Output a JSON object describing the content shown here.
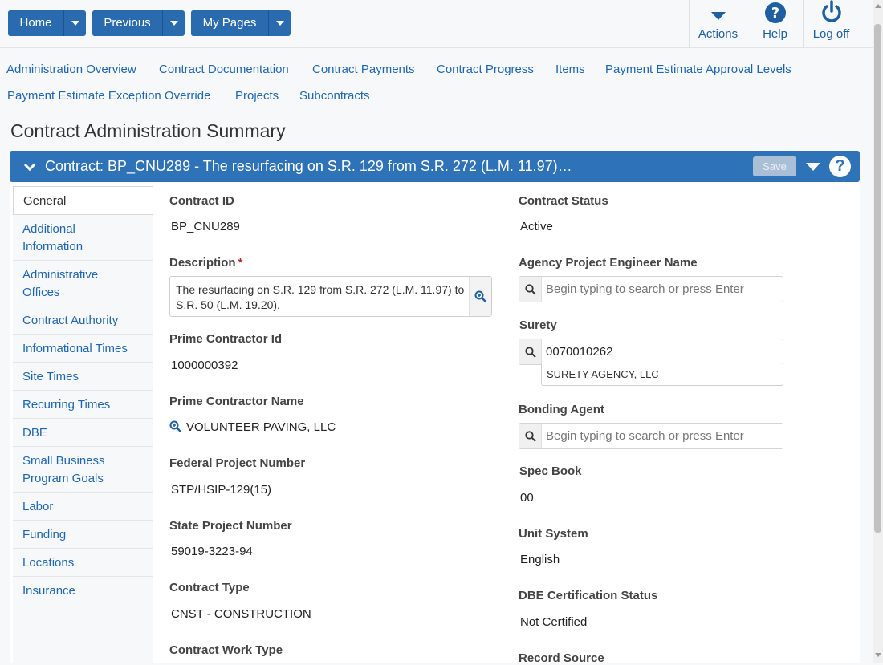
{
  "colors": {
    "brand_blue": "#2e72b8",
    "link_blue": "#1f66b0",
    "required_red": "#c0262d"
  },
  "topbar": {
    "home_label": "Home",
    "previous_label": "Previous",
    "mypages_label": "My Pages",
    "actions_label": "Actions",
    "help_label": "Help",
    "logoff_label": "Log off"
  },
  "nav": {
    "links": [
      "Administration Overview",
      "Contract Documentation",
      "Contract Payments",
      "Contract Progress",
      "Items",
      "Payment Estimate Approval Levels",
      "Payment Estimate Exception Override",
      "Projects",
      "Subcontracts"
    ]
  },
  "page_title": "Contract Administration Summary",
  "panel": {
    "title": "Contract: BP_CNU289 - The resurfacing on S.R. 129 from S.R. 272 (L.M. 11.97)…",
    "save_label": "Save",
    "help_glyph": "?"
  },
  "sidebar": {
    "items": [
      "General",
      "Additional\nInformation",
      "Administrative\nOffices",
      "Contract Authority",
      "Informational Times",
      "Site Times",
      "Recurring Times",
      "DBE",
      "Small Business\nProgram Goals",
      "Labor",
      "Funding",
      "Locations",
      "Insurance"
    ]
  },
  "form": {
    "contract_id_label": "Contract ID",
    "contract_id": "BP_CNU289",
    "description_label": "Description",
    "required_mark": "*",
    "description": "The resurfacing on S.R. 129 from S.R. 272 (L.M. 11.97) to S.R. 50 (L.M. 19.20).",
    "prime_contractor_id_label": "Prime Contractor Id",
    "prime_contractor_id": "1000000392",
    "prime_contractor_name_label": "Prime Contractor Name",
    "prime_contractor_name": "VOLUNTEER PAVING, LLC",
    "federal_project_number_label": "Federal Project Number",
    "federal_project_number": "STP/HSIP-129(15)",
    "state_project_number_label": "State Project Number",
    "state_project_number": "59019-3223-94",
    "contract_type_label": "Contract Type",
    "contract_type": "CNST - CONSTRUCTION",
    "contract_work_type_label": "Contract Work Type",
    "contract_status_label": "Contract Status",
    "contract_status": "Active",
    "agency_engineer_label": "Agency Project Engineer Name",
    "search_placeholder": "Begin typing to search or press Enter",
    "surety_label": "Surety",
    "surety_value": "0070010262",
    "surety_name": "SURETY AGENCY, LLC",
    "bonding_agent_label": "Bonding Agent",
    "spec_book_label": "Spec Book",
    "spec_book": "00",
    "unit_system_label": "Unit System",
    "unit_system": "English",
    "dbe_status_label": "DBE Certification Status",
    "dbe_status": "Not Certified",
    "record_source_label": "Record Source"
  }
}
